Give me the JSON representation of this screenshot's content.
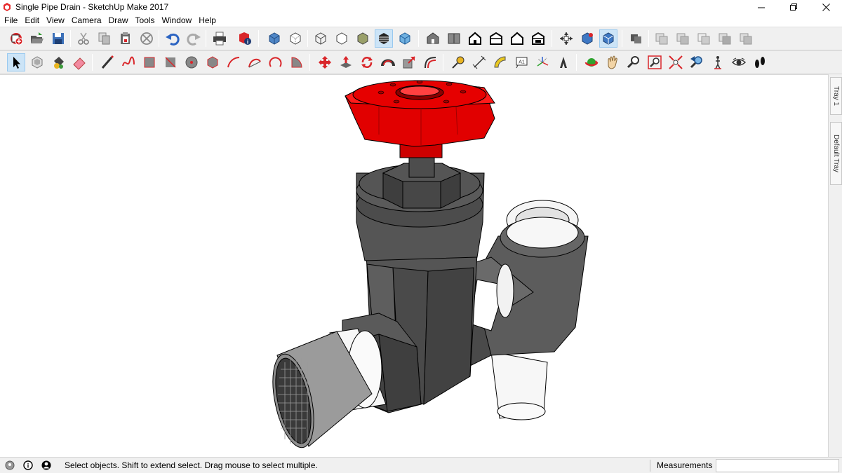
{
  "window": {
    "title": "Single Pipe Drain - SketchUp Make 2017",
    "app_icon": "sketchup-logo-icon",
    "controls": [
      "minimize-icon",
      "restore-icon",
      "close-icon"
    ]
  },
  "menu": {
    "items": [
      "File",
      "Edit",
      "View",
      "Camera",
      "Draw",
      "Tools",
      "Window",
      "Help"
    ]
  },
  "toolbar_top": {
    "tools": [
      {
        "icon": "new-model-icon"
      },
      {
        "icon": "open-icon"
      },
      {
        "icon": "save-icon"
      },
      {
        "icon": "cut-icon"
      },
      {
        "icon": "copy-icon"
      },
      {
        "icon": "paste-icon"
      },
      {
        "icon": "erase-selection-icon"
      },
      {
        "icon": "undo-icon"
      },
      {
        "icon": "redo-icon"
      },
      {
        "icon": "print-icon"
      },
      {
        "icon": "model-info-icon"
      },
      {
        "icon": "xray-icon"
      },
      {
        "icon": "back-edges-icon"
      },
      {
        "icon": "wireframe-icon"
      },
      {
        "icon": "hidden-line-icon"
      },
      {
        "icon": "shaded-icon"
      },
      {
        "icon": "shaded-textures-icon"
      },
      {
        "icon": "monochrome-icon"
      },
      {
        "icon": "iso-view-icon"
      },
      {
        "icon": "top-view-icon"
      },
      {
        "icon": "front-view-icon"
      },
      {
        "icon": "right-view-icon"
      },
      {
        "icon": "back-view-icon"
      },
      {
        "icon": "left-view-icon"
      },
      {
        "icon": "orbit-axes-icon"
      },
      {
        "icon": "perspective-icon"
      },
      {
        "icon": "two-point-icon"
      },
      {
        "icon": "components-icon"
      },
      {
        "icon": "warehouse-icon"
      },
      {
        "icon": "share-model-icon"
      },
      {
        "icon": "share-component-icon"
      },
      {
        "icon": "extension-warehouse-icon"
      },
      {
        "icon": "extension-manager-icon"
      }
    ],
    "active_tool": "shaded-textures-icon"
  },
  "toolbar_bottom": {
    "tools": [
      {
        "icon": "select-icon"
      },
      {
        "icon": "make-component-icon"
      },
      {
        "icon": "paint-bucket-icon"
      },
      {
        "icon": "eraser-icon"
      },
      {
        "icon": "line-icon"
      },
      {
        "icon": "freehand-icon"
      },
      {
        "icon": "rectangle-icon"
      },
      {
        "icon": "rotated-rectangle-icon"
      },
      {
        "icon": "circle-icon"
      },
      {
        "icon": "polygon-icon"
      },
      {
        "icon": "arc-icon"
      },
      {
        "icon": "two-point-arc-icon"
      },
      {
        "icon": "three-point-arc-icon"
      },
      {
        "icon": "pie-icon"
      },
      {
        "icon": "move-icon"
      },
      {
        "icon": "push-pull-icon"
      },
      {
        "icon": "rotate-icon"
      },
      {
        "icon": "follow-me-icon"
      },
      {
        "icon": "scale-icon"
      },
      {
        "icon": "offset-icon"
      },
      {
        "icon": "tape-measure-icon"
      },
      {
        "icon": "dimension-icon"
      },
      {
        "icon": "protractor-icon"
      },
      {
        "icon": "text-icon"
      },
      {
        "icon": "axes-icon"
      },
      {
        "icon": "3d-text-icon"
      },
      {
        "icon": "orbit-icon"
      },
      {
        "icon": "pan-icon"
      },
      {
        "icon": "zoom-icon"
      },
      {
        "icon": "zoom-window-icon"
      },
      {
        "icon": "zoom-extents-icon"
      },
      {
        "icon": "previous-view-icon"
      },
      {
        "icon": "position-camera-icon"
      },
      {
        "icon": "look-around-icon"
      },
      {
        "icon": "walk-icon"
      }
    ],
    "active_tool": "select-icon"
  },
  "tray": {
    "tabs": [
      "Tray 1",
      "Default Tray"
    ]
  },
  "model": {
    "name": "Single Pipe Drain",
    "handle_color": "#e00000",
    "body_color": "#5a5a5a",
    "pipe_color": "#ffffff",
    "strainer_color": "#9a9a9a"
  },
  "status": {
    "icons": [
      "geo-location-icon",
      "credits-icon",
      "user-account-icon"
    ],
    "message": "Select objects. Shift to extend select. Drag mouse to select multiple.",
    "measurements_label": "Measurements",
    "measurements_value": ""
  }
}
